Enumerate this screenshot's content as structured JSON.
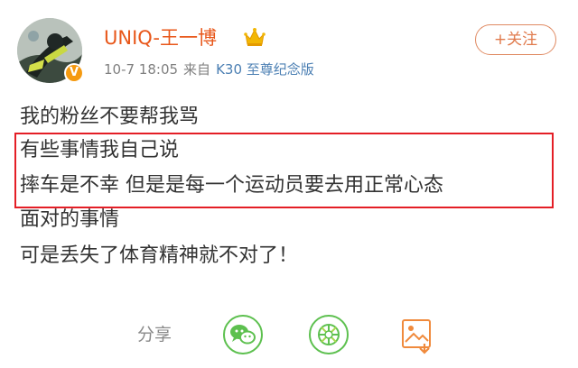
{
  "post": {
    "username": "UNIQ-王一博",
    "date": "10-7 18:05",
    "source_prefix": "来自",
    "source": "K30 至尊纪念版",
    "follow_label": "+关注",
    "lines": [
      "我的粉丝不要帮我骂",
      "有些事情我自己说",
      "摔车是不幸 但是是每一个运动员要去用正常心态",
      "面对的事情",
      "可是丢失了体育精神就不对了！"
    ]
  },
  "share": {
    "label": "分享",
    "targets": [
      "wechat-icon",
      "moments-icon",
      "save-image-icon"
    ]
  },
  "colors": {
    "username": "#e8571a",
    "source_link": "#4b7fb3",
    "highlight_border": "#e41e26",
    "wechat_green": "#5dc04f"
  }
}
